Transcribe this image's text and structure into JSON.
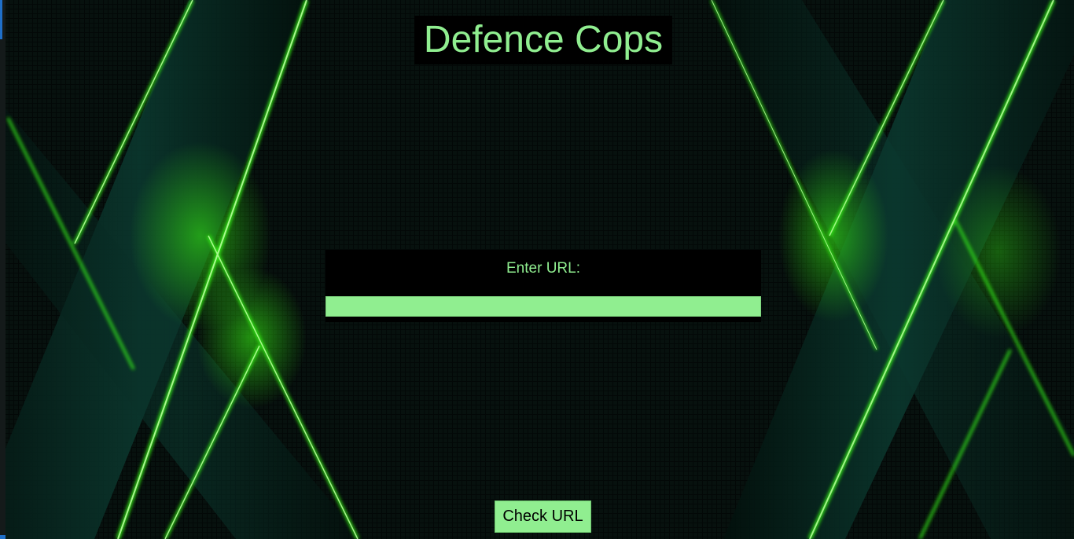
{
  "app": {
    "title": "Defence Cops"
  },
  "form": {
    "label": "Enter URL:",
    "url_value": "",
    "url_placeholder": ""
  },
  "actions": {
    "check_label": "Check URL"
  },
  "theme": {
    "accent": "#90ee90",
    "panel": "#000000",
    "background": "#030807",
    "glow": "#39ff14"
  }
}
